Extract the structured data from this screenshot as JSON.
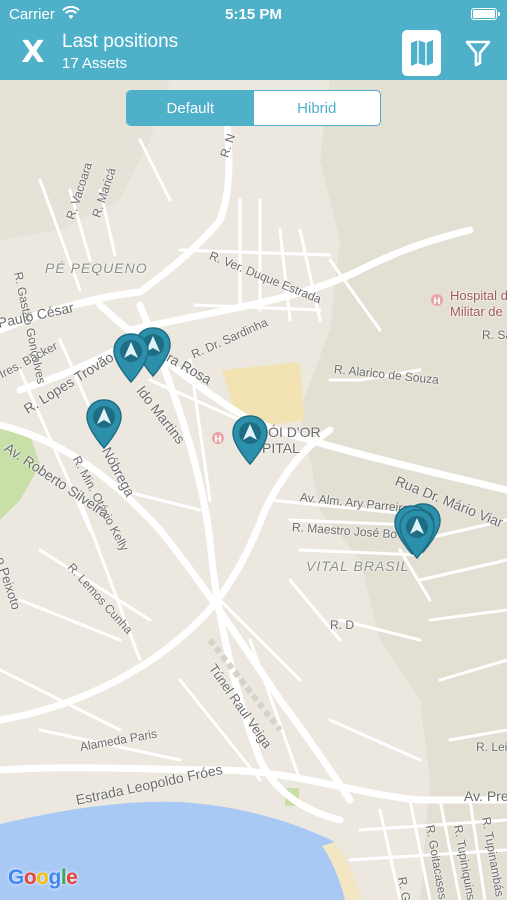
{
  "status_bar": {
    "carrier": "Carrier",
    "time": "5:15 PM"
  },
  "header": {
    "close_label": "X",
    "title": "Last positions",
    "subtitle": "17 Assets"
  },
  "map_type": {
    "options": [
      "Default",
      "Hibrid"
    ],
    "selected": "Default"
  },
  "map_labels": [
    "R. Gastão Gonçalves",
    "R. Vacoara",
    "R. Maricá",
    "R. N",
    "PÉ PEQUENO",
    "R. Ver. Duque Estrada",
    "Paulo César",
    "Ires. Backer",
    "R. Lopes Trovão",
    "R. Dr. Sardinha",
    "Hospital de",
    "Militar de",
    "R. Sa",
    "R. Alarico de Souza",
    "ra Rosa",
    "ldo Martins",
    "Nóbrega",
    "R. Min. Otávio Kelly",
    "Av. Roberto Silveira",
    "RÓI D'OR",
    "PITAL",
    "Rua Dr. Mário Viar",
    "Av. Alm. Ary Parreira",
    "R. Maestro José Bo",
    "VITAL BRASIL",
    "o Peixoto",
    "R. Lemos Cunha",
    "R. D",
    "Túnel Raul Veiga",
    "Alameda Paris",
    "Estrada Leopoldo Fróes",
    "Av. Pre",
    "R. Lei",
    "R. Tupinambás",
    "R. Tupiniquins",
    "R. Goitacases",
    "R. Go"
  ],
  "google_logo": "Google",
  "colors": {
    "accent": "#4fb0ca",
    "pin": "#2d90aa",
    "pin_dark": "#1e6d85",
    "water": "#a9c9f5",
    "park": "#c8dfa8"
  }
}
